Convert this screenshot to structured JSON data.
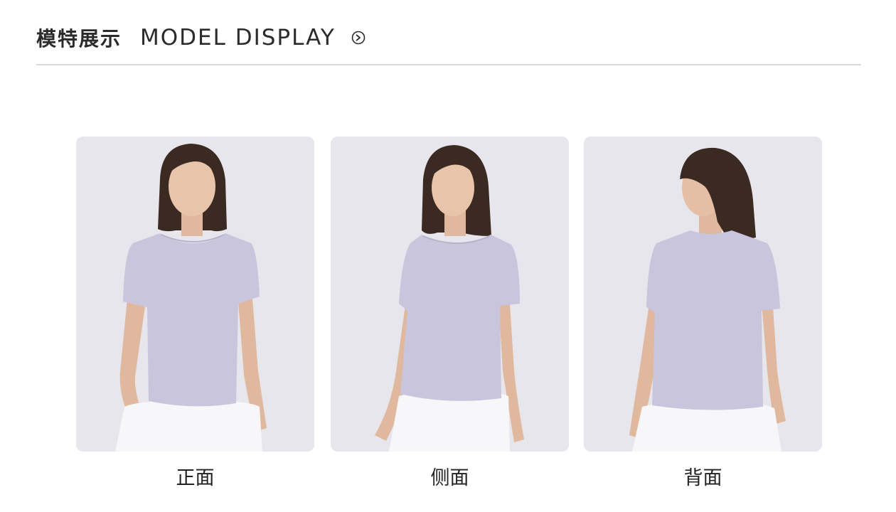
{
  "header": {
    "title_cn": "模特展示",
    "title_en": "MODEL DISPLAY",
    "arrow_icon": "circle-arrow-right-icon"
  },
  "colors": {
    "background": "#e6e6ec",
    "shirt": "#c9c5dc",
    "hair": "#3b2a22",
    "skin": "#e4bfa6",
    "skirt": "#f7f7f9",
    "divider": "#d9d9d9"
  },
  "views": [
    {
      "label": "正面",
      "pose": "front"
    },
    {
      "label": "侧面",
      "pose": "side"
    },
    {
      "label": "背面",
      "pose": "back"
    }
  ]
}
